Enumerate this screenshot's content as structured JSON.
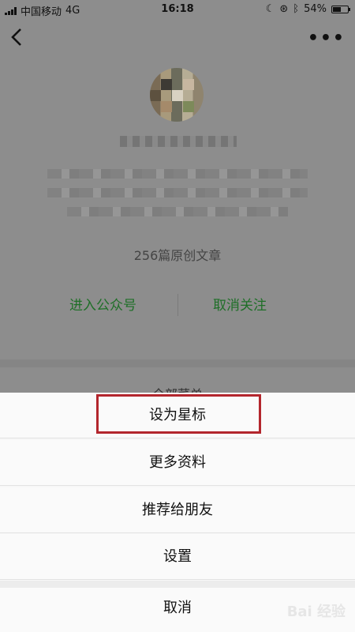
{
  "status_bar": {
    "carrier": "中国移动",
    "network": "4G",
    "time": "16:18",
    "battery": "54%",
    "battery_level": 0.54
  },
  "profile": {
    "articles_count": "256篇原创文章",
    "enter_account_label": "进入公众号",
    "unfollow_label": "取消关注",
    "peek_text": "全部菜单"
  },
  "action_sheet": {
    "items": [
      "设为星标",
      "更多资料",
      "推荐给朋友",
      "设置"
    ],
    "cancel_label": "取消",
    "highlight_color": "#b3262d"
  },
  "watermark": "Bai 经验",
  "colors": {
    "accent_green": "#1e6f27"
  }
}
